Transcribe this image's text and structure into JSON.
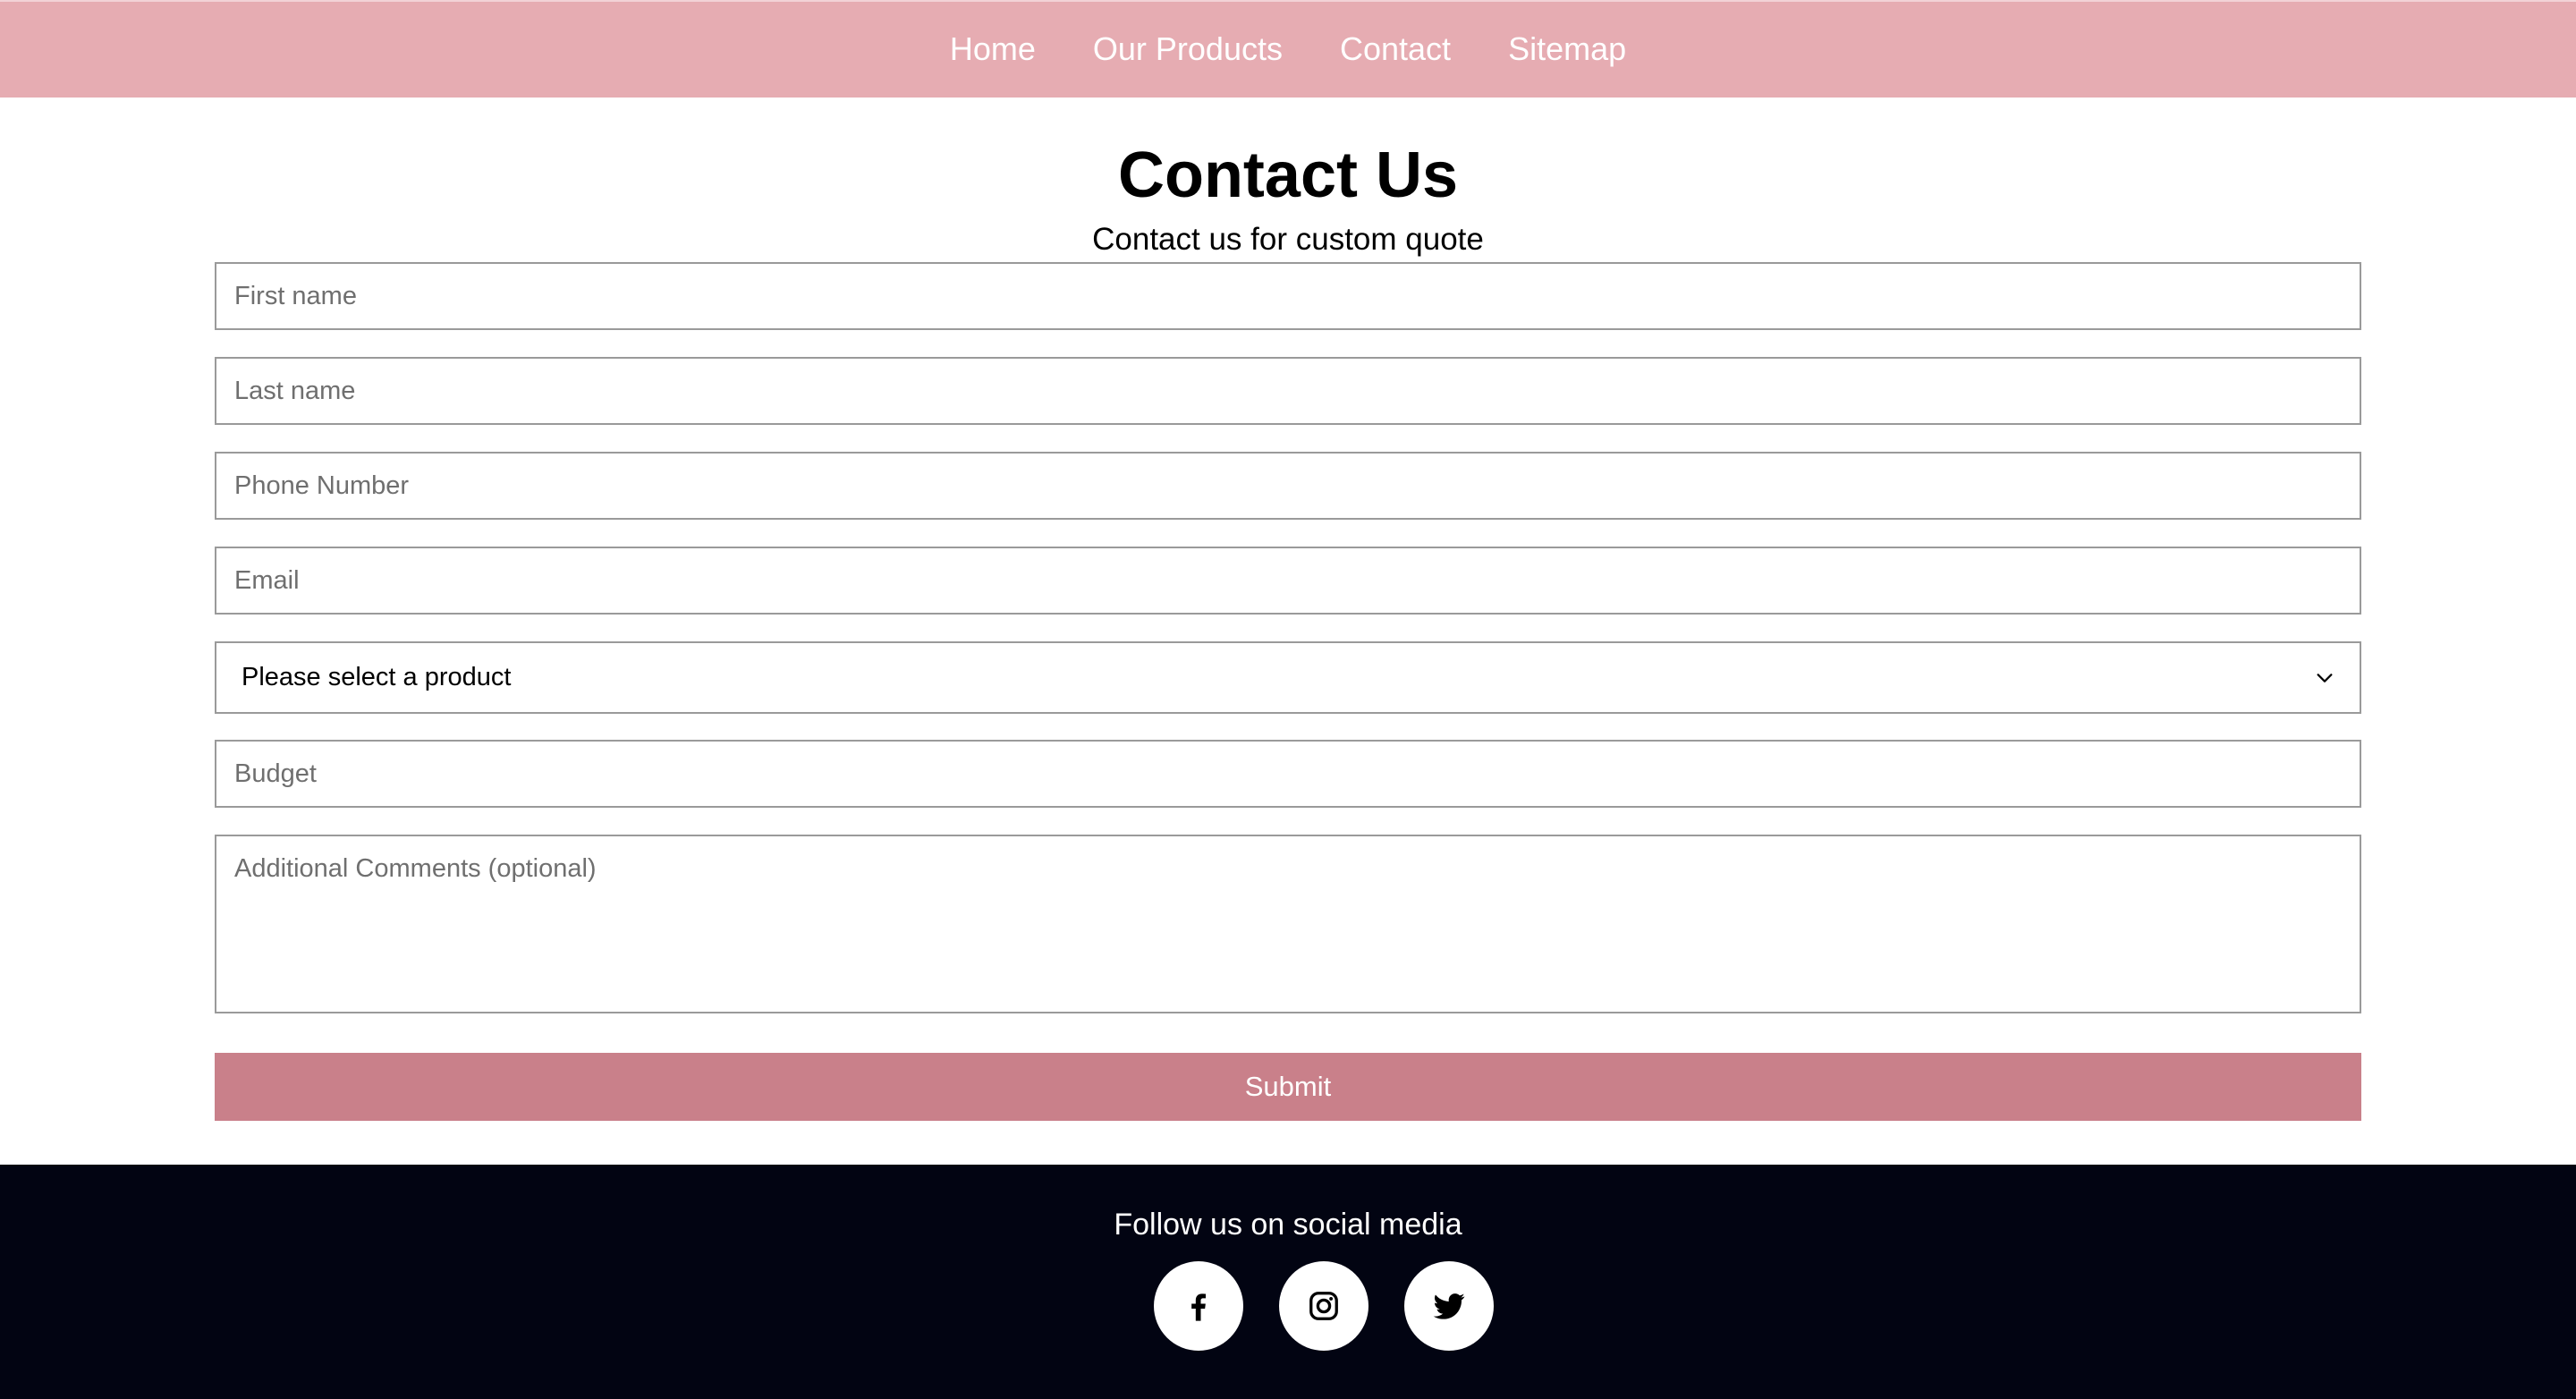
{
  "nav": {
    "items": [
      {
        "label": "Home"
      },
      {
        "label": "Our Products"
      },
      {
        "label": "Contact"
      },
      {
        "label": "Sitemap"
      }
    ]
  },
  "header": {
    "title": "Contact Us",
    "subtitle": "Contact us for custom quote"
  },
  "form": {
    "first_name": {
      "placeholder": "First name",
      "value": ""
    },
    "last_name": {
      "placeholder": "Last name",
      "value": ""
    },
    "phone": {
      "placeholder": "Phone Number",
      "value": ""
    },
    "email": {
      "placeholder": "Email",
      "value": ""
    },
    "product_select": {
      "selected": "Please select a product"
    },
    "budget": {
      "placeholder": "Budget",
      "value": ""
    },
    "comments": {
      "placeholder": "Additional Comments (optional)",
      "value": ""
    },
    "submit_label": "Submit"
  },
  "footer": {
    "follow_text": "Follow us on social media",
    "social": [
      {
        "icon": "facebook-icon"
      },
      {
        "icon": "instagram-icon"
      },
      {
        "icon": "twitter-icon"
      }
    ]
  },
  "colors": {
    "nav_bg": "#e6acb2",
    "button_bg": "#c9808a",
    "footer_bg": "#020412"
  }
}
